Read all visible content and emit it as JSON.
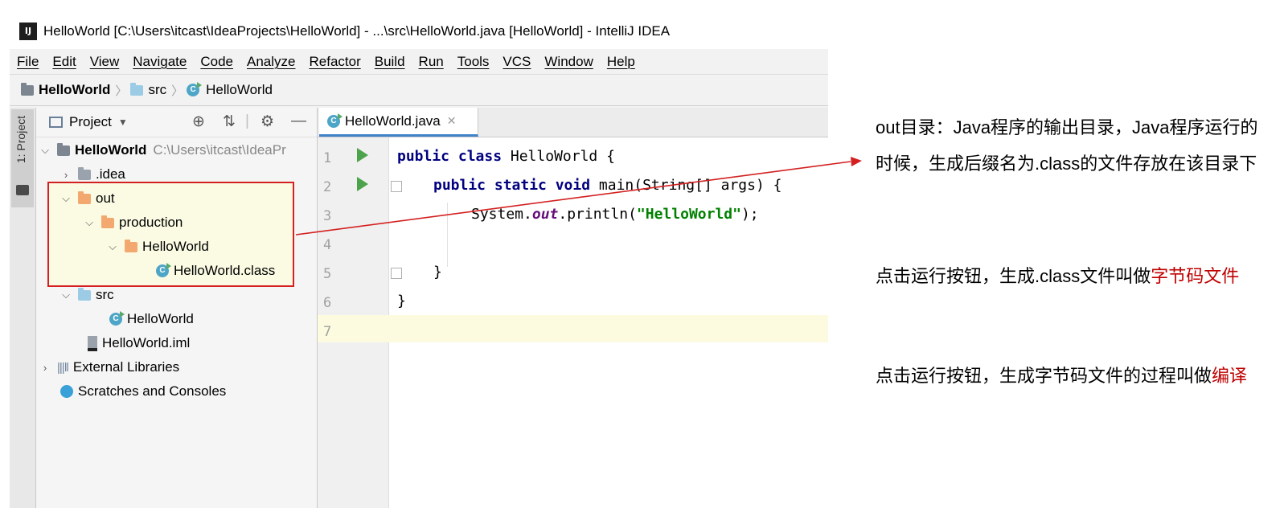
{
  "window": {
    "title": "HelloWorld [C:\\Users\\itcast\\IdeaProjects\\HelloWorld] - ...\\src\\HelloWorld.java [HelloWorld] - IntelliJ IDEA",
    "logo_text": "IJ"
  },
  "menu": [
    "File",
    "Edit",
    "View",
    "Navigate",
    "Code",
    "Analyze",
    "Refactor",
    "Build",
    "Run",
    "Tools",
    "VCS",
    "Window",
    "Help"
  ],
  "breadcrumb": [
    "HelloWorld",
    "src",
    "HelloWorld"
  ],
  "sidebar": {
    "tab_label": "1: Project"
  },
  "project_panel": {
    "title": "Project",
    "tree": [
      {
        "label": "HelloWorld",
        "path": "C:\\Users\\itcast\\IdeaPr"
      },
      {
        "label": ".idea"
      },
      {
        "label": "out"
      },
      {
        "label": "production"
      },
      {
        "label": "HelloWorld"
      },
      {
        "label": "HelloWorld.class"
      },
      {
        "label": "src"
      },
      {
        "label": "HelloWorld"
      },
      {
        "label": "HelloWorld.iml"
      },
      {
        "label": "External Libraries"
      },
      {
        "label": "Scratches and Consoles"
      }
    ]
  },
  "editor": {
    "tab_label": "HelloWorld.java",
    "line_numbers": [
      "1",
      "2",
      "3",
      "4",
      "5",
      "6",
      "7"
    ],
    "code": {
      "l1_kw": "public class",
      "l1_rest": " HelloWorld {",
      "l2_kw": "public static void",
      "l2_rest": " main(String[] args) {",
      "l3_a": "System.",
      "l3_field": "out",
      "l3_b": ".println(",
      "l3_str": "\"HelloWorld\"",
      "l3_c": ");",
      "l5": "}",
      "l6": "}"
    }
  },
  "annotations": {
    "p1": "out目录：Java程序的输出目录，Java程序运行的时候，生成后缀名为.class的文件存放在该目录下",
    "p2_text": "点击运行按钮，生成.class文件叫做",
    "p2_red": "字节码文件",
    "p3_text": "点击运行按钮，生成字节码文件的过程叫做",
    "p3_red": "编译"
  },
  "colors": {
    "highlight_border": "#d42020",
    "emphasis_red": "#c00000",
    "keyword": "#000080",
    "string": "#008000"
  }
}
